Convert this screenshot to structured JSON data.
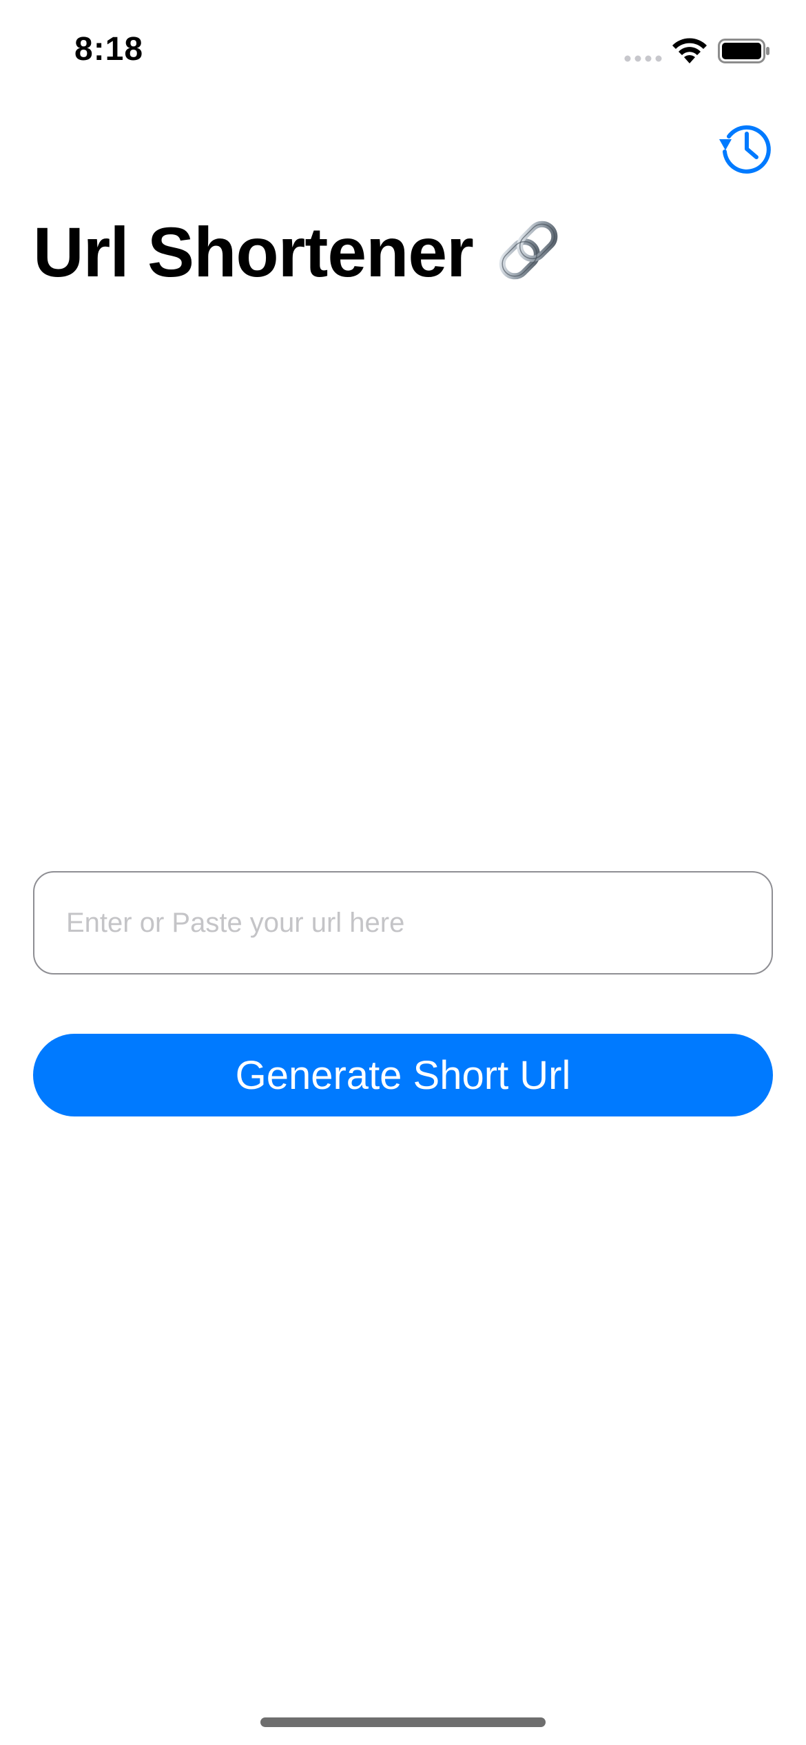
{
  "status_bar": {
    "time": "8:18"
  },
  "header": {
    "title": "Url Shortener",
    "title_icon": "link-emoji-icon"
  },
  "toolbar": {
    "history_icon": "history-icon"
  },
  "form": {
    "url_input": {
      "value": "",
      "placeholder": "Enter or Paste your url here"
    },
    "generate_label": "Generate Short Url"
  },
  "colors": {
    "accent": "#007aff",
    "input_border": "#8e8e93",
    "placeholder": "#c4c4c7"
  }
}
